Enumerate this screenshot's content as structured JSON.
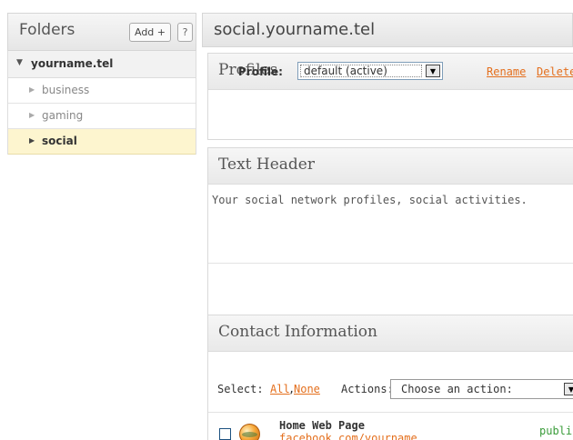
{
  "sidebar": {
    "title": "Folders",
    "add_label": "Add +",
    "help_label": "?",
    "root": "yourname.tel",
    "items": [
      {
        "label": "business",
        "active": false
      },
      {
        "label": "gaming",
        "active": false
      },
      {
        "label": "social",
        "active": true
      }
    ]
  },
  "main": {
    "title": "social.yourname.tel",
    "profiles": {
      "heading": "Profiles",
      "label": "Profile:",
      "selected": "default (active)",
      "rename": "Rename",
      "delete": "Delete"
    },
    "text_header": {
      "heading": "Text Header",
      "content": "Your social network profiles, social activities."
    },
    "contact": {
      "heading": "Contact Information",
      "select_label": "Select:",
      "all": "All",
      "comma": ",",
      "none": "None",
      "actions_label": "Actions:",
      "actions_placeholder": "Choose an action:",
      "rows": [
        {
          "name": "Home Web Page",
          "url": "facebook.com/yourname",
          "visibility": "public",
          "icon": "globe-icon"
        }
      ]
    }
  },
  "colors": {
    "link": "#e46f1d",
    "active_folder_bg": "#fdf5cf",
    "public": "#3a9c3a"
  }
}
